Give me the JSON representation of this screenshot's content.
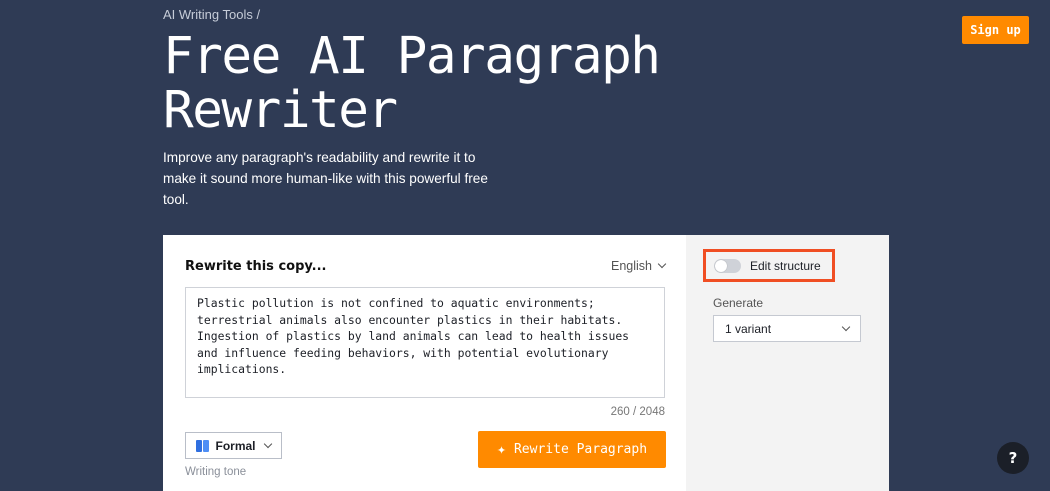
{
  "breadcrumb": "AI Writing Tools /",
  "header": {
    "signup_label": "Sign up"
  },
  "hero": {
    "title": "Free AI Paragraph Rewriter",
    "subtitle": "Improve any paragraph's readability and rewrite it to make it sound more human-like with this powerful free tool."
  },
  "editor": {
    "label": "Rewrite this copy...",
    "language": "English",
    "input_text": "Plastic pollution is not confined to aquatic environments; terrestrial animals also encounter plastics in their habitats. Ingestion of plastics by land animals can lead to health issues and influence feeding behaviors, with potential evolutionary implications.",
    "char_count": "260 / 2048",
    "tone_value": "Formal",
    "tone_label": "Writing tone",
    "rewrite_label": "Rewrite Paragraph"
  },
  "options": {
    "edit_structure_label": "Edit structure",
    "edit_structure_on": false,
    "generate_label": "Generate",
    "variant_value": "1 variant"
  },
  "help": {
    "label": "?"
  },
  "colors": {
    "background": "#2f3b55",
    "accent": "#ff8a00",
    "highlight": "#f04e23"
  }
}
